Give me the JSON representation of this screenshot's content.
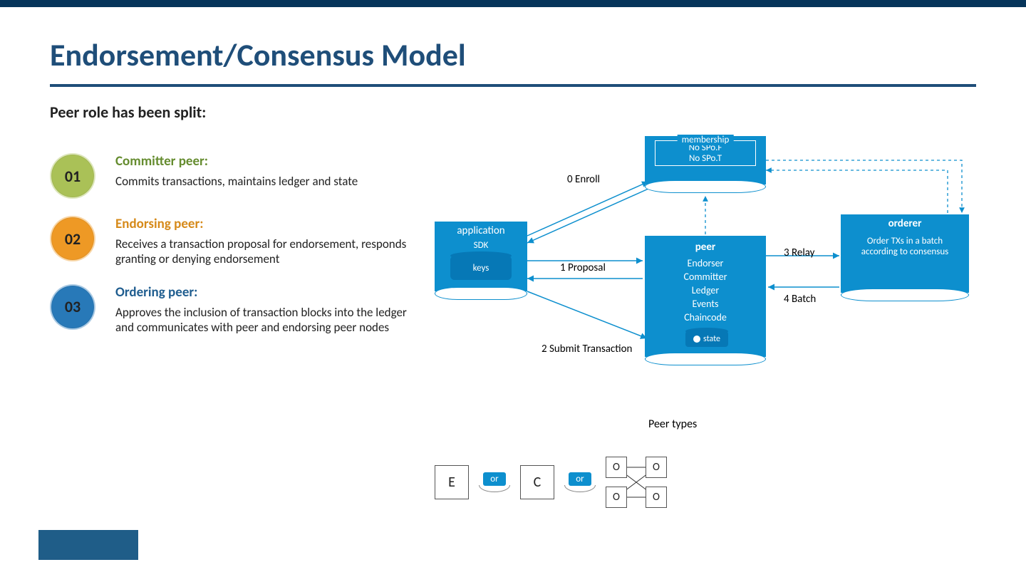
{
  "title": "Endorsement/Consensus Model",
  "subtitle": "Peer role has been split:",
  "peers": [
    {
      "num": "01",
      "head": "Committer peer:",
      "desc": "Commits transactions, maintains ledger and state"
    },
    {
      "num": "02",
      "head": "Endorsing peer:",
      "desc": "Receives a transaction proposal for endorsement, responds granting or denying endorsement"
    },
    {
      "num": "03",
      "head": "Ordering peer:",
      "desc": "Approves the inclusion of transaction blocks into the ledger and communicates with peer and endorsing peer nodes"
    }
  ],
  "diagram": {
    "membership": {
      "title": "membership",
      "line1": "No SPo.F",
      "line2": "No SPo.T"
    },
    "application": {
      "title": "application",
      "sub": "SDK",
      "keys": "keys"
    },
    "peer": {
      "title": "peer",
      "lines": [
        "Endorser",
        "Committer",
        "Ledger",
        "Events",
        "Chaincode"
      ],
      "state": "state"
    },
    "orderer": {
      "title": "orderer",
      "desc": "Order TXs in a batch according to consensus"
    },
    "labels": {
      "enroll": "0 Enroll",
      "proposal": "1 Proposal",
      "submit": "2 Submit Transaction",
      "relay": "3 Relay",
      "batch": "4 Batch"
    },
    "peer_types_label": "Peer types",
    "types": {
      "E": "E",
      "C": "C",
      "O": "O",
      "or": "or"
    }
  }
}
